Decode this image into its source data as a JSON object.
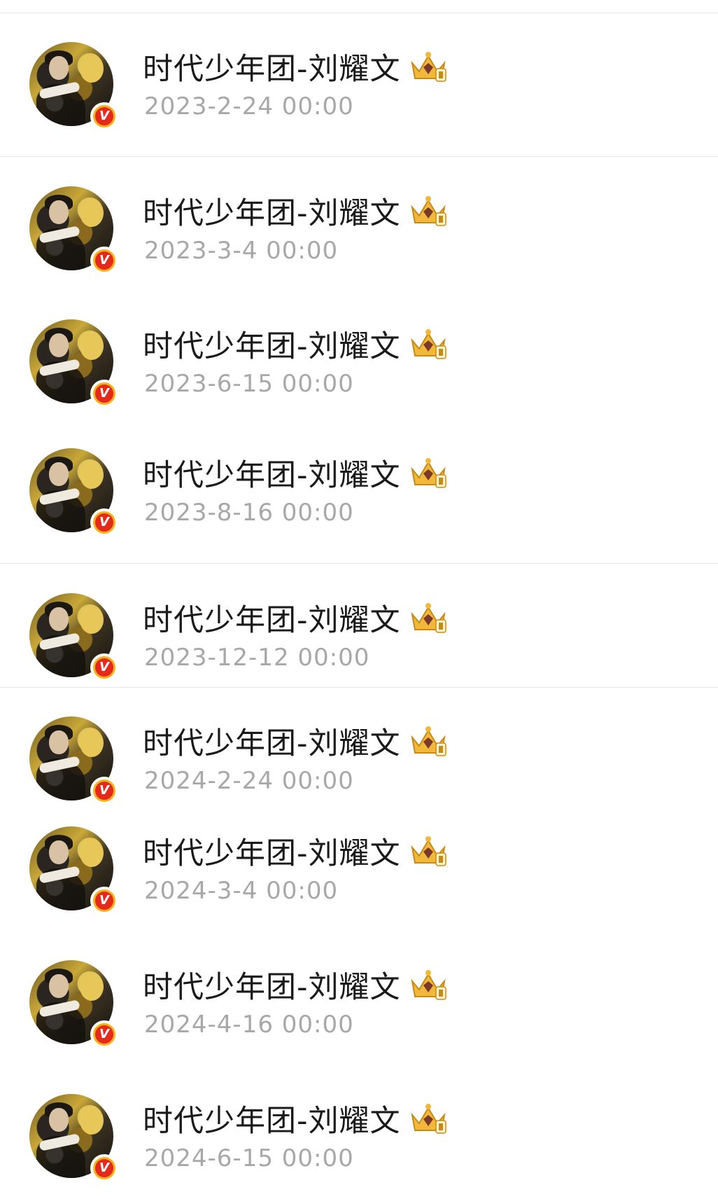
{
  "posts": [
    {
      "username": "时代少年团-刘耀文",
      "timestamp": "2023-2-24 00:00",
      "badge_letter": "V"
    },
    {
      "username": "时代少年团-刘耀文",
      "timestamp": "2023-3-4 00:00",
      "badge_letter": "V"
    },
    {
      "username": "时代少年团-刘耀文",
      "timestamp": "2023-6-15 00:00",
      "badge_letter": "V"
    },
    {
      "username": "时代少年团-刘耀文",
      "timestamp": "2023-8-16 00:00",
      "badge_letter": "V"
    },
    {
      "username": "时代少年团-刘耀文",
      "timestamp": "2023-12-12 00:00",
      "badge_letter": "V"
    },
    {
      "username": "时代少年团-刘耀文",
      "timestamp": "2024-2-24 00:00",
      "badge_letter": "V"
    },
    {
      "username": "时代少年团-刘耀文",
      "timestamp": "2024-3-4 00:00",
      "badge_letter": "V"
    },
    {
      "username": "时代少年团-刘耀文",
      "timestamp": "2024-4-16 00:00",
      "badge_letter": "V"
    },
    {
      "username": "时代少年团-刘耀文",
      "timestamp": "2024-6-15 00:00",
      "badge_letter": "V"
    }
  ],
  "icons": {
    "verified": "verified-v-icon",
    "membership": "crown-icon"
  },
  "colors": {
    "username": "#1a1a1a",
    "timestamp": "#a8a8a8",
    "verified_red": "#e52a1c",
    "verified_ring": "#f5b31b",
    "crown_gold": "#f2b83a",
    "divider": "#e9e9e9"
  }
}
